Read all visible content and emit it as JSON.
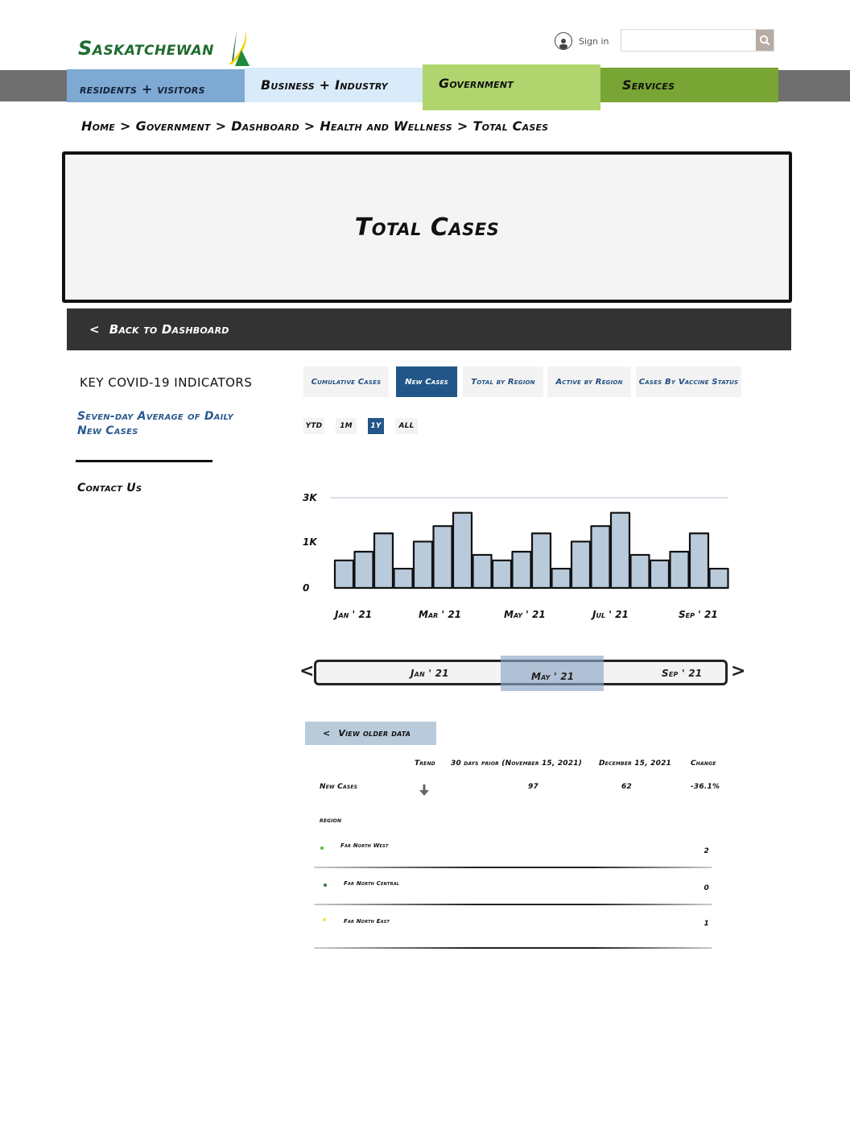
{
  "header": {
    "logo_text": "Saskatchewan",
    "sign_in_label": "Sign in",
    "search_placeholder": "",
    "search_value": ""
  },
  "nav": {
    "items": [
      {
        "label": "residents + visitors"
      },
      {
        "label": "Business + Industry"
      },
      {
        "label": "Government",
        "active": true
      },
      {
        "label": "Services"
      }
    ]
  },
  "breadcrumb": {
    "items": [
      "Home",
      "Government",
      "Dashboard",
      "Health and Wellness",
      "Total Cases"
    ],
    "separator": ">"
  },
  "page": {
    "title": "Total Cases",
    "back_label": "Back to Dashboard",
    "back_chevron": "<"
  },
  "sidebar": {
    "heading": "KEY COVID-19 INDICATORS",
    "link": "Seven-day Average of Daily New Cases",
    "contact": "Contact Us"
  },
  "tabs": [
    {
      "label": "Cumulative Cases",
      "active": false
    },
    {
      "label": "New Cases",
      "active": true
    },
    {
      "label": "Total by Region",
      "active": false
    },
    {
      "label": "Active by Region",
      "active": false
    },
    {
      "label": "Cases By Vaccine Status",
      "active": false
    }
  ],
  "ranges": [
    {
      "label": "YTD",
      "active": false
    },
    {
      "label": "1M",
      "active": false
    },
    {
      "label": "1Y",
      "active": true
    },
    {
      "label": "ALL",
      "active": false
    }
  ],
  "colors": {
    "accent_blue": "#225688",
    "bar_fill": "#b9cadb",
    "nav_residents": "#7ea9d2",
    "nav_business": "#d9ebfa",
    "nav_government": "#b0d46e",
    "nav_services": "#78a533",
    "logo_green": "#1f6b2f",
    "logo_yellow": "#f2d500"
  },
  "chart_data": {
    "type": "bar",
    "title": "",
    "xlabel": "",
    "ylabel": "",
    "y_ticks": [
      {
        "label": "0",
        "value": 0
      },
      {
        "label": "1K",
        "value": 1000
      },
      {
        "label": "3K",
        "value": 3000
      }
    ],
    "x_ticks": [
      "Jan ' 21",
      "Mar ' 21",
      "May ' 21",
      "Jul ' 21",
      "Sep ' 21"
    ],
    "gridlines": [
      3000
    ],
    "ylim": [
      0,
      3500
    ],
    "values": [
      600,
      790,
      1390,
      420,
      1020,
      1720,
      2320,
      720,
      600,
      790,
      1390,
      420,
      1020,
      1720,
      2320,
      720,
      600,
      790,
      1390,
      420
    ]
  },
  "slider": {
    "labels": [
      "Jan ' 21",
      "May ' 21",
      "Sep ' 21"
    ],
    "prev_label": "<",
    "next_label": ">"
  },
  "older": {
    "label": "View older data",
    "chevron": "<"
  },
  "table": {
    "headers": [
      "Trend",
      "30 days prior (November 15, 2021)",
      "December 15, 2021",
      "Change"
    ],
    "row": {
      "label": "New Cases",
      "trend": "down",
      "prior": "97",
      "current": "62",
      "change": "-36.1%"
    }
  },
  "regions": {
    "label": "region",
    "items": [
      {
        "name": "Far North West",
        "value": "2",
        "color": "#5fb548"
      },
      {
        "name": "Far North Central",
        "value": "0",
        "color": "#2d7a3a"
      },
      {
        "name": "Far North East",
        "value": "1",
        "color": "#f5e04a"
      }
    ]
  }
}
